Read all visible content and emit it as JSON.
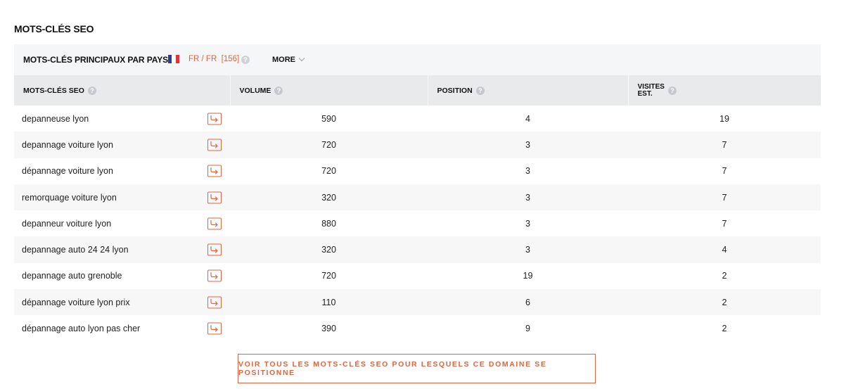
{
  "section_title": "MOTS-CLÉS SEO",
  "panel": {
    "title": "MOTS-CLÉS PRINCIPAUX PAR PAYS",
    "country_label": "FR / FR",
    "country_count": "[156]",
    "more_label": "MORE",
    "flag_colors": [
      "#2a3b9c",
      "#ffffff",
      "#e2333b"
    ]
  },
  "table": {
    "headers": {
      "keyword": "MOTS-CLÉS SEO",
      "volume": "VOLUME",
      "position": "POSITION",
      "visits_line1": "VISITES",
      "visits_line2": "EST."
    },
    "rows": [
      {
        "keyword": "depanneuse lyon",
        "volume": "590",
        "position": "4",
        "visits": "19"
      },
      {
        "keyword": "depannage voiture lyon",
        "volume": "720",
        "position": "3",
        "visits": "7"
      },
      {
        "keyword": "dépannage voiture lyon",
        "volume": "720",
        "position": "3",
        "visits": "7"
      },
      {
        "keyword": "remorquage voiture lyon",
        "volume": "320",
        "position": "3",
        "visits": "7"
      },
      {
        "keyword": "depanneur voiture lyon",
        "volume": "880",
        "position": "3",
        "visits": "7"
      },
      {
        "keyword": "depannage auto 24 24 lyon",
        "volume": "320",
        "position": "3",
        "visits": "4"
      },
      {
        "keyword": "depannage auto grenoble",
        "volume": "720",
        "position": "19",
        "visits": "2"
      },
      {
        "keyword": "dépannage voiture lyon prix",
        "volume": "110",
        "position": "6",
        "visits": "2"
      },
      {
        "keyword": "dépannage auto lyon pas cher",
        "volume": "390",
        "position": "9",
        "visits": "2"
      }
    ]
  },
  "cta_label": "VOIR TOUS LES MOTS-CLÉS SEO POUR LESQUELS CE DOMAINE SE POSITIONNE",
  "colors": {
    "accent": "#e0643f",
    "header_bg": "#e9eaec",
    "panel_bg": "#f5f6f8"
  },
  "icons": {
    "help": "question-circle-icon",
    "link": "redirect-arrow-icon",
    "chevron": "chevron-down-icon",
    "flag": "france-flag-icon"
  }
}
